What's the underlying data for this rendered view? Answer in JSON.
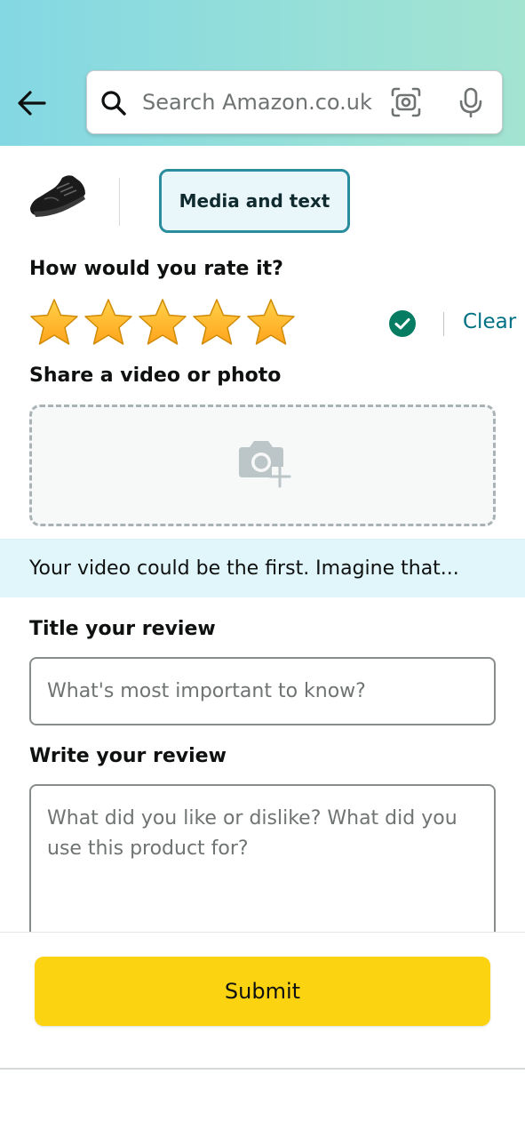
{
  "header": {
    "back_icon": "back-arrow-icon",
    "search": {
      "placeholder": "Search Amazon.co.uk",
      "search_icon": "search-icon",
      "lens_icon": "camera-lens-icon",
      "mic_icon": "microphone-icon"
    },
    "gradient_colors": [
      "#84d8e3",
      "#a3e4d1"
    ]
  },
  "product": {
    "thumbnail_icon": "shoe-thumbnail",
    "tab_label": "Media and text"
  },
  "rating": {
    "label": "How would you rate it?",
    "value": 5,
    "max": 5,
    "check_icon": "check-circle-icon",
    "clear_label": "Clear"
  },
  "media": {
    "label": "Share a video or photo",
    "upload_icon": "add-photo-icon"
  },
  "banner": {
    "text": "Your video could be the first. Imagine that..."
  },
  "review_title": {
    "label": "Title your review",
    "placeholder": "What's most important to know?"
  },
  "review_body": {
    "label": "Write your review",
    "placeholder": "What did you like or dislike? What did you use this product for?"
  },
  "footer": {
    "submit_label": "Submit"
  },
  "colors": {
    "accent_teal": "#007185",
    "tab_border": "#2a8d9e",
    "star_fill": "#ffa41c",
    "check_green": "#067d62",
    "submit_yellow": "#fcd311",
    "banner_bg": "#e0f6fa"
  }
}
